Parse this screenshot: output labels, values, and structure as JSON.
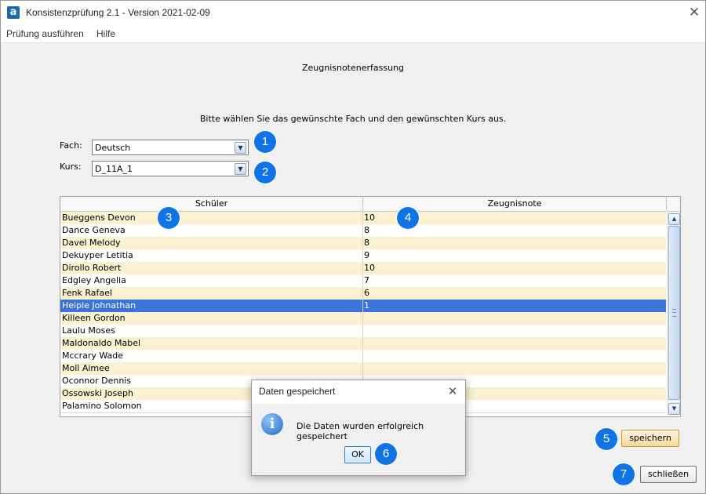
{
  "window": {
    "title": "Konsistenzprüfung 2.1 - Version 2021-02-09",
    "icon_letter": "a",
    "close_glyph": "✕"
  },
  "menu": [
    "Prüfung ausführen",
    "Hilfe"
  ],
  "form": {
    "heading": "Zeugnisnotenerfassung",
    "instruction": "Bitte wählen Sie das gewünschte Fach und den gewünschten Kurs aus.",
    "fach_label": "Fach:",
    "fach_value": "Deutsch",
    "kurs_label": "Kurs:",
    "kurs_value": "D_11A_1"
  },
  "table": {
    "headers": [
      "Schüler",
      "Zeugnisnote"
    ],
    "rows": [
      {
        "name": "Bueggens Devon",
        "grade": "10"
      },
      {
        "name": "Dance Geneva",
        "grade": "8"
      },
      {
        "name": "Davel Melody",
        "grade": "8"
      },
      {
        "name": "Dekuyper Letitia",
        "grade": "9"
      },
      {
        "name": "Dirollo Robert",
        "grade": "10"
      },
      {
        "name": "Edgley Angelia",
        "grade": "7"
      },
      {
        "name": "Fenk Rafael",
        "grade": "6"
      },
      {
        "name": "Heiple Johnathan",
        "grade": "1"
      },
      {
        "name": "Killeen Gordon",
        "grade": ""
      },
      {
        "name": "Laulu Moses",
        "grade": ""
      },
      {
        "name": "Maldonaldo Mabel",
        "grade": ""
      },
      {
        "name": "Mccrary Wade",
        "grade": ""
      },
      {
        "name": "Moll Aimee",
        "grade": ""
      },
      {
        "name": "Oconnor Dennis",
        "grade": ""
      },
      {
        "name": "Ossowski Joseph",
        "grade": ""
      },
      {
        "name": "Palamino Solomon",
        "grade": ""
      }
    ],
    "selected_row": 7
  },
  "buttons": {
    "save": "speichern",
    "close": "schließen"
  },
  "dialog": {
    "title": "Daten gespeichert",
    "message": "Die Daten wurden erfolgreich gespeichert",
    "ok": "OK",
    "icon_glyph": "i"
  },
  "badges": [
    "1",
    "2",
    "3",
    "4",
    "5",
    "6",
    "7"
  ],
  "colors": {
    "badge": "#1174e6",
    "row_alt": "#fbf0cf",
    "row_selected": "#3b74d9"
  }
}
